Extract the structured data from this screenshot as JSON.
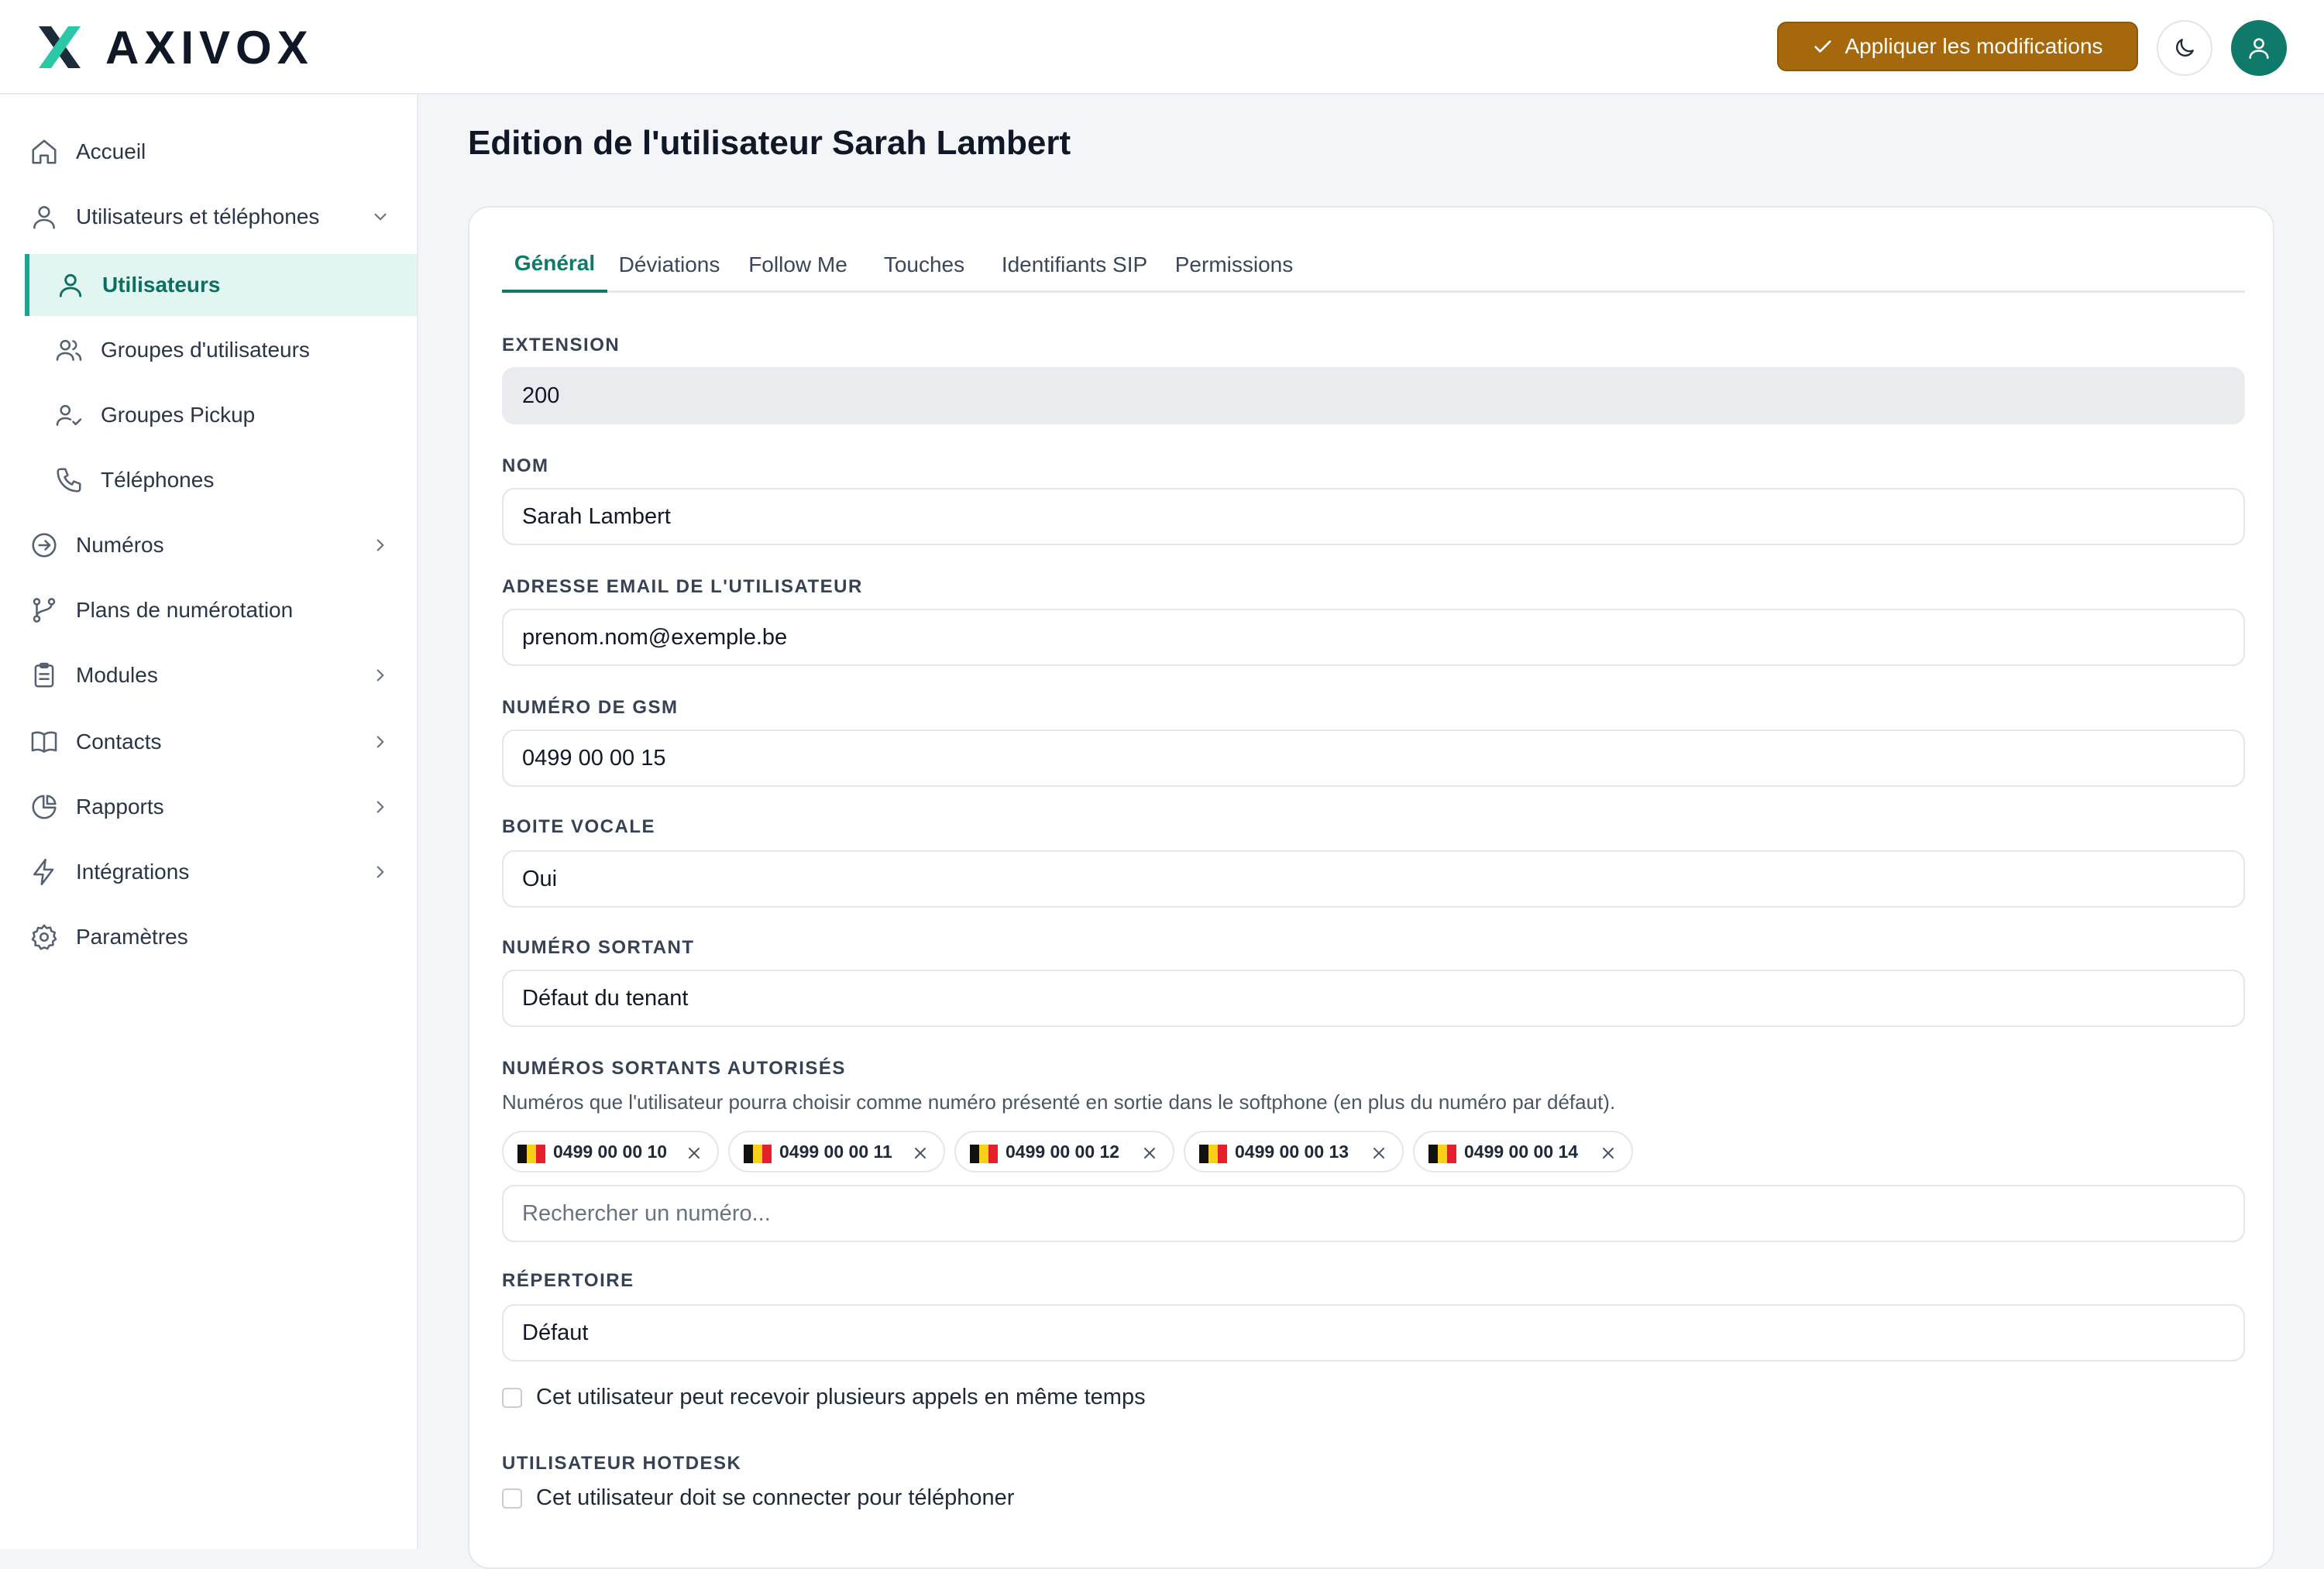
{
  "brand": {
    "name": "AXIVOX",
    "accent": "#0f7a6a",
    "apply_color": "#a6680c"
  },
  "header": {
    "apply_label": "Appliquer les modifications"
  },
  "sidebar": {
    "items": [
      {
        "label": "Accueil",
        "icon": "home-icon"
      },
      {
        "label": "Utilisateurs et téléphones",
        "icon": "user-icon",
        "expanded": true
      },
      {
        "label": "Utilisateurs",
        "icon": "user-icon",
        "active": true
      },
      {
        "label": "Groupes d'utilisateurs",
        "icon": "users-icon"
      },
      {
        "label": "Groupes Pickup",
        "icon": "user-check-icon"
      },
      {
        "label": "Téléphones",
        "icon": "phone-icon"
      },
      {
        "label": "Numéros",
        "icon": "arrow-circle-icon"
      },
      {
        "label": "Plans de numérotation",
        "icon": "git-branch-icon"
      },
      {
        "label": "Modules",
        "icon": "clipboard-icon"
      },
      {
        "label": "Contacts",
        "icon": "book-icon"
      },
      {
        "label": "Rapports",
        "icon": "pie-chart-icon"
      },
      {
        "label": "Intégrations",
        "icon": "zap-icon"
      },
      {
        "label": "Paramètres",
        "icon": "gear-icon"
      }
    ]
  },
  "page": {
    "title": "Edition de l'utilisateur Sarah Lambert"
  },
  "tabs": [
    "Général",
    "Déviations",
    "Follow Me",
    "Touches",
    "Identifiants SIP",
    "Permissions"
  ],
  "form": {
    "extension": {
      "label": "EXTENSION",
      "value": "200"
    },
    "nom": {
      "label": "NOM",
      "value": "Sarah Lambert"
    },
    "email": {
      "label": "ADRESSE EMAIL DE L'UTILISATEUR",
      "value": "prenom.nom@exemple.be"
    },
    "gsm": {
      "label": "NUMÉRO DE GSM",
      "value": "0499 00 00 15"
    },
    "voicemail": {
      "label": "BOITE VOCALE",
      "value": "Oui"
    },
    "outgoing": {
      "label": "NUMÉRO SORTANT",
      "value": "Défaut du tenant"
    },
    "allowed": {
      "label": "NUMÉROS SORTANTS AUTORISÉS",
      "helper": "Numéros que l'utilisateur pourra choisir comme numéro présenté en sortie dans le softphone (en plus du numéro par défaut).",
      "chips": [
        "0499 00 00 10",
        "0499 00 00 11",
        "0499 00 00 12",
        "0499 00 00 13",
        "0499 00 00 14"
      ],
      "search_placeholder": "Rechercher un numéro..."
    },
    "directory": {
      "label": "RÉPERTOIRE",
      "value": "Défaut"
    },
    "multi_calls": {
      "label": "Cet utilisateur peut recevoir plusieurs appels en même temps",
      "checked": false
    },
    "hotdesk": {
      "label": "UTILISATEUR HOTDESK",
      "checkbox_label": "Cet utilisateur doit se connecter pour téléphoner",
      "checked": false
    }
  }
}
